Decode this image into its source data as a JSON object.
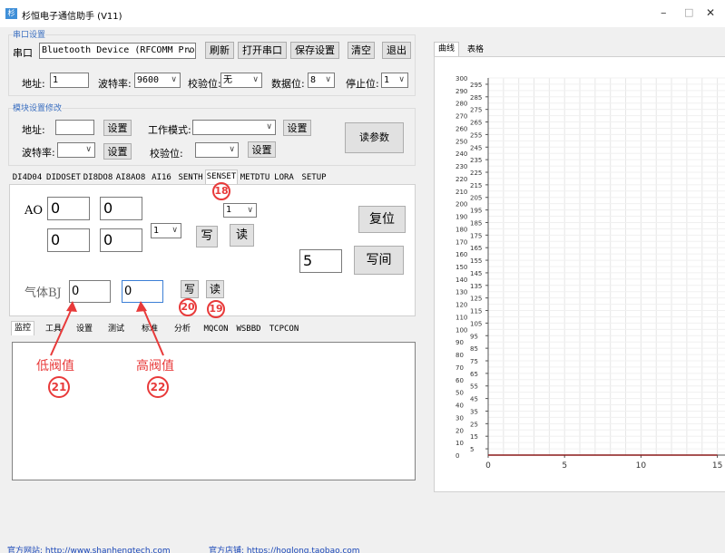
{
  "window": {
    "title": "杉恒电子通信助手  (V11)",
    "controls": [
      "–",
      "□",
      "✕"
    ]
  },
  "serial": {
    "group_title": "串口设置",
    "port_label": "串口",
    "port_value": "Bluetooth Device (RFCOMM Protoc",
    "refresh": "刷新",
    "open": "打开串口",
    "save": "保存设置",
    "clear": "清空",
    "exit": "退出",
    "addr_label": "地址:",
    "addr_value": "1",
    "baud_label": "波特率:",
    "baud_value": "9600",
    "parity_label": "校验位:",
    "parity_value": "无",
    "databits_label": "数据位:",
    "databits_value": "8",
    "stopbits_label": "停止位:",
    "stopbits_value": "1"
  },
  "module": {
    "group_title": "模块设置修改",
    "addr_label": "地址:",
    "set": "设置",
    "mode_label": "工作模式:",
    "baud_label": "波特率:",
    "parity_label": "校验位:",
    "read_params": "读参数"
  },
  "module_tabs": [
    "DI4D04",
    "DIDOSET",
    "DI8DO8",
    "AI8AO8",
    "AI16",
    "SENTH",
    "SENSET",
    "METDTU",
    "LORA",
    "SETUP"
  ],
  "senset": {
    "ao_label": "AO",
    "ao_values": [
      "0",
      "0",
      "0",
      "0"
    ],
    "select_small": "1",
    "select_top": "1",
    "write": "写",
    "read": "读",
    "reset": "复位",
    "interval_value": "5",
    "write_interval": "写间",
    "gas_label": "气体BJ",
    "gas_low": "0",
    "gas_high": "0",
    "gas_write": "写",
    "gas_read": "读"
  },
  "bottom_tabs": [
    "监控",
    "工具",
    "设置",
    "测试",
    "标准",
    "分析",
    "MQCON",
    "WSBBD",
    "TCPCON"
  ],
  "annotations": {
    "n18": "18",
    "n19": "19",
    "n20": "20",
    "n21": "21",
    "n22": "22",
    "low_threshold": "低阀值",
    "high_threshold": "高阀值"
  },
  "chart_tabs": [
    "曲线",
    "表格"
  ],
  "chart_data": {
    "type": "line",
    "yticks_major": [
      0,
      10,
      20,
      30,
      40,
      50,
      60,
      70,
      80,
      90,
      100,
      110,
      120,
      130,
      140,
      150,
      160,
      170,
      180,
      190,
      200,
      210,
      220,
      230,
      240,
      250,
      260,
      270,
      280,
      290,
      300
    ],
    "yticks_minor": [
      5,
      15,
      25,
      35,
      45,
      55,
      65,
      75,
      85,
      95,
      105,
      115,
      125,
      135,
      145,
      155,
      165,
      175,
      185,
      195,
      205,
      215,
      225,
      235,
      245,
      255,
      265,
      275,
      285,
      295
    ],
    "xticks": [
      0,
      5,
      10,
      15
    ],
    "ylim": [
      0,
      300
    ],
    "xlim": [
      0,
      15
    ],
    "series": [
      {
        "values": [
          0,
          0,
          0,
          0,
          0,
          0,
          0,
          0,
          0,
          0,
          0,
          0,
          0,
          0,
          0,
          0
        ]
      }
    ],
    "line_color": "#8b1a1a",
    "grid": true
  },
  "footer": {
    "site": "官方网站:  http://www.shanhengtech.com",
    "shop": "官方店铺:  https://hoglong.taobao.com"
  }
}
